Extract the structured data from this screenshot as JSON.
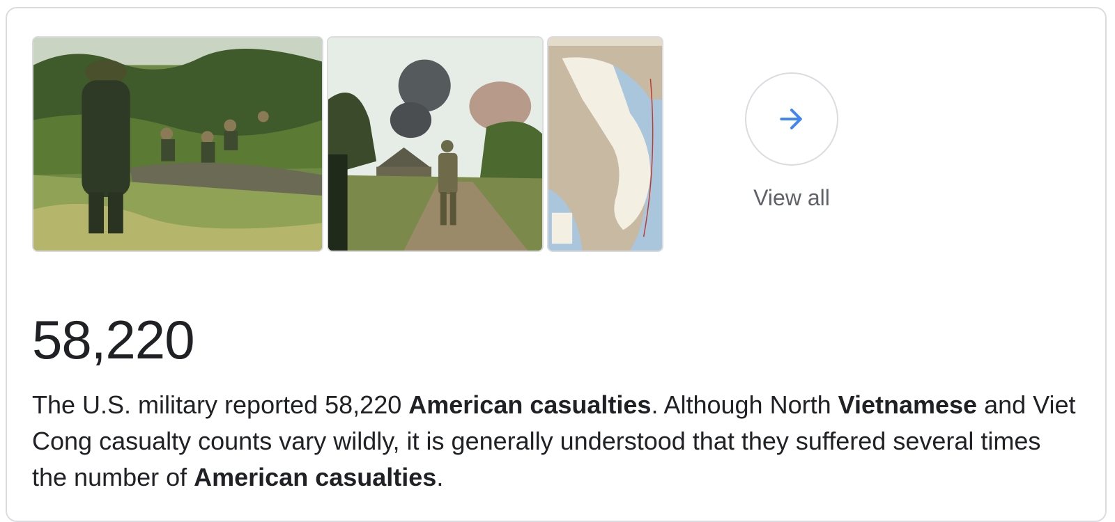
{
  "images": [
    {
      "alt_icon": "soldiers-in-swamp-photo"
    },
    {
      "alt_icon": "soldier-with-explosions-photo"
    },
    {
      "alt_icon": "vietnam-map-image"
    }
  ],
  "view_all": {
    "label": "View all",
    "icon": "arrow-right-icon",
    "accent": "#4285f4"
  },
  "answer": {
    "number": "58,220",
    "description": {
      "p1": "The U.S. military reported 58,220 ",
      "b1": "American casualties",
      "p2": ". Although North ",
      "b2": "Vietnamese",
      "p3": " and Viet Cong casualty counts vary wildly, it is generally understood that they suffered several times the number of ",
      "b3": "American casualties",
      "p4": "."
    }
  }
}
